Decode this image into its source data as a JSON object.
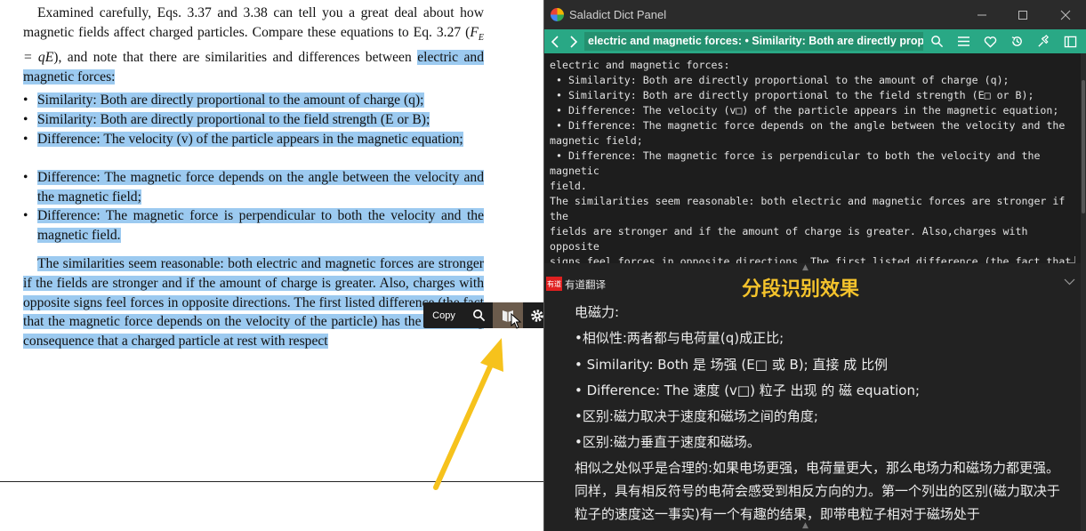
{
  "document": {
    "para1": "Examined carefully, Eqs. 3.37 and 3.38 can tell you a great deal about how magnetic fields affect charged particles. Compare these equations to Eq. 3.27",
    "para1_eq_open": "(",
    "para1_eq_lhs": "F",
    "para1_eq_sub": "E",
    "para1_eq_mid": " = q",
    "para1_eq_rhs": "E",
    "para1_tail": "), and note that there are similarities and differences between",
    "para1_hl": "electric and magnetic forces:",
    "bullets": [
      "Similarity: Both are directly proportional to the amount of charge (q);",
      "Similarity: Both are directly proportional to the field strength (E or B);",
      "Difference: The velocity (v) of the particle appears in the magnetic equation;",
      "Difference: The magnetic force depends on the angle between the velocity and the magnetic field;",
      "Difference: The magnetic force is perpendicular to both the velocity and the magnetic field."
    ],
    "para2": "The similarities seem reasonable: both electric and magnetic forces are stronger if the fields are stronger and if the amount of charge is greater. Also, charges with opposite signs feel forces in opposite directions. The first listed difference (the fact that the magnetic force depends on the velocity of the particle) has the interesting consequence that a charged particle at rest with respect",
    "bullet_dot": "•"
  },
  "selection_toolbar": {
    "copy_label": "Copy"
  },
  "panel": {
    "title": "Saladict Dict Panel",
    "query": "electric and magnetic forces: • Similarity: Both are directly proportional to the amount of charge (q); • Similarity: Both are directly",
    "source_text": "electric and magnetic forces:\n • Similarity: Both are directly proportional to the amount of charge (q);\n • Similarity: Both are directly proportional to the field strength (E□ or B);\n • Difference: The velocity (v□) of the particle appears in the magnetic equation;\n • Difference: The magnetic force depends on the angle between the velocity and the\nmagnetic field;\n • Difference: The magnetic force is perpendicular to both the velocity and the magnetic\nfield.\nThe similarities seem reasonable: both electric and magnetic forces are stronger if the\nfields are stronger and if the amount of charge is greater. Also,charges with opposite\nsigns feel forces in opposite directions. The first listed difference (the fact that the\nmagnetic force depends on the velocity of the parti-cle) has the interesting consequence\nthat a charged particle at rest with respect",
    "dict_logo": "有道",
    "dict_name": "有道翻译",
    "caption": "分段识别效果",
    "translation_lines": [
      "电磁力:",
      "•相似性:两者都与电荷量(q)成正比;",
      "• Similarity: Both 是 场强 (E□ 或 B); 直接 成 比例",
      "• Difference: The 速度 (v□) 粒子 出现 的 磁 equation;",
      "•区别:磁力取决于速度和磁场之间的角度;",
      "•区别:磁力垂直于速度和磁场。"
    ],
    "translation_para": "相似之处似乎是合理的:如果电场更强，电荷量更大，那么电场力和磁场力都更强。同样，具有相反符号的电荷会感受到相反方向的力。第一个列出的区别(磁力取决于粒子的速度这一事实)有一个有趣的结果，即带电粒子相对于磁场处于"
  },
  "icons": [
    "search-icon",
    "dictionary-icon",
    "settings-icon",
    "back-icon",
    "forward-icon",
    "menu-icon",
    "heart-icon",
    "history-icon",
    "pin-icon",
    "sidebar-icon",
    "minimize-icon",
    "maximize-icon",
    "close-icon",
    "arrow-annotation"
  ],
  "colors": {
    "highlight": "#9ccaf0",
    "toolbar_green": "#29a885",
    "panel_bg": "#222222",
    "caption_yellow": "#f4c32c",
    "arrow_yellow": "#f6c21c"
  }
}
